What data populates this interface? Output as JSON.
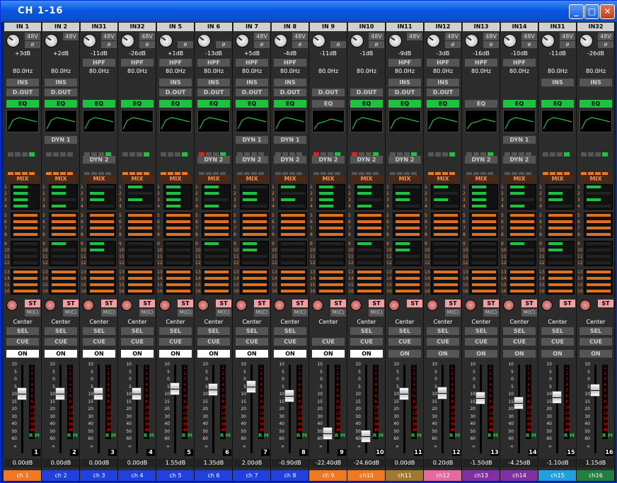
{
  "window": {
    "title": "CH 1-16",
    "min_label": "_",
    "max_label": "□",
    "close_label": "✕"
  },
  "labels": {
    "mix": "MIX",
    "st": "ST",
    "mc": "M(C)",
    "sel": "SEL",
    "cue": "CUE",
    "on": "ON",
    "ins": "INS",
    "dout": "D.OUT",
    "eq": "EQ",
    "dyn1": "DYN 1",
    "dyn2": "DYN 2",
    "hpf": "HPF",
    "rm": "R M",
    "b48": "48V",
    "phase": "ø"
  },
  "fader_scale": [
    "10",
    "5",
    "0",
    "5",
    "10",
    "15",
    "20",
    "30",
    "40",
    "50",
    "60",
    "∞"
  ],
  "meter_scale": [
    "1",
    "2",
    "3",
    "4",
    "5",
    "6",
    "8",
    "10",
    "12",
    "20",
    "30",
    "40"
  ],
  "mix_numbers": {
    "g1": [
      "1",
      "2",
      "3",
      "4"
    ],
    "g2": [
      "5",
      "6",
      "7",
      "8"
    ],
    "g3": [
      "9",
      "10",
      "11",
      "12"
    ],
    "g4": [
      "13",
      "14",
      "15",
      "16"
    ]
  },
  "channels": [
    {
      "input": "IN 1",
      "gain": "+3dB",
      "hpf_freq": "80.0Hz",
      "b48": false,
      "phase": false,
      "hpf": true,
      "ins": false,
      "dout": false,
      "eq": true,
      "dyn1": true,
      "dyn2": true,
      "pan": "Center",
      "mc": false,
      "sel": false,
      "on": true,
      "level": "0.00dB",
      "number": "1",
      "name": "ch 1",
      "color": "#f07820",
      "fader": 0.66
    },
    {
      "input": "IN 2",
      "gain": "+2dB",
      "hpf_freq": "80.0Hz",
      "b48": false,
      "phase": true,
      "hpf": true,
      "ins": false,
      "dout": false,
      "eq": true,
      "dyn1": false,
      "dyn2": true,
      "pan": "Center",
      "mc": false,
      "sel": false,
      "on": true,
      "level": "0.00dB",
      "number": "2",
      "name": "ch 2",
      "color": "#2040e0",
      "fader": 0.66
    },
    {
      "input": "IN31",
      "gain": "-11dB",
      "hpf_freq": "80.0Hz",
      "b48": false,
      "phase": false,
      "hpf": false,
      "ins": true,
      "dout": true,
      "eq": true,
      "dyn1": true,
      "dyn2": false,
      "pan": "Center",
      "mc": false,
      "sel": false,
      "on": true,
      "level": "0.00dB",
      "number": "3",
      "name": "ch 3",
      "color": "#2040e0",
      "fader": 0.66
    },
    {
      "input": "IN32",
      "gain": "-26dB",
      "hpf_freq": "80.0Hz",
      "b48": false,
      "phase": false,
      "hpf": false,
      "ins": true,
      "dout": true,
      "eq": true,
      "dyn1": true,
      "dyn2": true,
      "pan": "Center",
      "mc": false,
      "sel": false,
      "on": true,
      "level": "0.00dB",
      "number": "4",
      "name": "ch 4",
      "color": "#2040e0",
      "fader": 0.66
    },
    {
      "input": "IN 5",
      "gain": "+1dB",
      "hpf_freq": "80.0Hz",
      "b48": true,
      "phase": false,
      "hpf": false,
      "ins": false,
      "dout": false,
      "eq": true,
      "dyn1": true,
      "dyn2": true,
      "pan": "Center",
      "mc": false,
      "sel": false,
      "on": true,
      "level": "1.55dB",
      "number": "5",
      "name": "ch 5",
      "color": "#2040e0",
      "fader": 0.72
    },
    {
      "input": "IN 6",
      "gain": "-13dB",
      "hpf_freq": "80.0Hz",
      "b48": true,
      "phase": false,
      "hpf": false,
      "ins": false,
      "dout": false,
      "eq": true,
      "dyn1": true,
      "dyn2": false,
      "pan": "Center",
      "mc": false,
      "sel": false,
      "on": true,
      "level": "1.35dB",
      "number": "6",
      "name": "ch 6",
      "color": "#2040e0",
      "fader": 0.71
    },
    {
      "input": "IN 7",
      "gain": "+5dB",
      "hpf_freq": "80.0Hz",
      "b48": false,
      "phase": false,
      "hpf": false,
      "ins": false,
      "dout": false,
      "eq": true,
      "dyn1": false,
      "dyn2": false,
      "pan": "Center",
      "mc": false,
      "sel": false,
      "on": true,
      "level": "2.00dB",
      "number": "7",
      "name": "ch 7",
      "color": "#2040e0",
      "fader": 0.74
    },
    {
      "input": "IN 8",
      "gain": "-4dB",
      "hpf_freq": "80.0Hz",
      "b48": false,
      "phase": false,
      "hpf": false,
      "ins": false,
      "dout": false,
      "eq": true,
      "dyn1": false,
      "dyn2": false,
      "pan": "Center",
      "mc": false,
      "sel": false,
      "on": true,
      "level": "-0.90dB",
      "number": "8",
      "name": "ch 8",
      "color": "#2040e0",
      "fader": 0.63
    },
    {
      "input": "IN 9",
      "gain": "-11dB",
      "hpf_freq": "80.0Hz",
      "b48": true,
      "phase": false,
      "hpf": true,
      "ins": true,
      "dout": false,
      "eq": false,
      "dyn1": true,
      "dyn2": false,
      "pan": "Center",
      "mc": false,
      "sel": true,
      "on": true,
      "level": "-22.40dB",
      "number": "9",
      "name": "ch 9",
      "color": "#f07820",
      "fader": 0.19
    },
    {
      "input": "IN10",
      "gain": "-1dB",
      "hpf_freq": "80.0Hz",
      "b48": false,
      "phase": false,
      "hpf": true,
      "ins": true,
      "dout": false,
      "eq": true,
      "dyn1": true,
      "dyn2": false,
      "pan": "Center",
      "mc": false,
      "sel": false,
      "on": true,
      "level": "-24.60dB",
      "number": "10",
      "name": "ch10",
      "color": "#f07820",
      "fader": 0.16
    },
    {
      "input": "IN11",
      "gain": "-9dB",
      "hpf_freq": "80.0Hz",
      "b48": false,
      "phase": true,
      "hpf": false,
      "ins": false,
      "dout": false,
      "eq": true,
      "dyn1": true,
      "dyn2": false,
      "pan": "Center",
      "mc": true,
      "sel": false,
      "on": false,
      "level": "0.00dB",
      "number": "11",
      "name": "ch11",
      "color": "#a07830",
      "fader": 0.66
    },
    {
      "input": "IN12",
      "gain": "-3dB",
      "hpf_freq": "80.0Hz",
      "b48": false,
      "phase": false,
      "hpf": false,
      "ins": false,
      "dout": false,
      "eq": true,
      "dyn1": true,
      "dyn2": true,
      "pan": "Center",
      "mc": false,
      "sel": false,
      "on": false,
      "level": "0.20dB",
      "number": "12",
      "name": "ch12",
      "color": "#e868a0",
      "fader": 0.67
    },
    {
      "input": "IN13",
      "gain": "-16dB",
      "hpf_freq": "80.0Hz",
      "b48": false,
      "phase": false,
      "hpf": false,
      "ins": true,
      "dout": true,
      "eq": false,
      "dyn1": true,
      "dyn2": false,
      "pan": "Center",
      "mc": false,
      "sel": false,
      "on": false,
      "level": "-1.50dB",
      "number": "13",
      "name": "ch13",
      "color": "#8030a0",
      "fader": 0.61
    },
    {
      "input": "IN14",
      "gain": "-10dB",
      "hpf_freq": "80.0Hz",
      "b48": false,
      "phase": false,
      "hpf": false,
      "ins": true,
      "dout": true,
      "eq": true,
      "dyn1": false,
      "dyn2": false,
      "pan": "Center",
      "mc": false,
      "sel": false,
      "on": false,
      "level": "-4.25dB",
      "number": "14",
      "name": "ch14",
      "color": "#8030a0",
      "fader": 0.55
    },
    {
      "input": "IN31",
      "gain": "-11dB",
      "hpf_freq": "80.0Hz",
      "b48": false,
      "phase": false,
      "hpf": true,
      "ins": false,
      "dout": true,
      "eq": true,
      "dyn1": true,
      "dyn2": true,
      "pan": "Center",
      "mc": true,
      "sel": false,
      "on": false,
      "level": "-1.10dB",
      "number": "15",
      "name": "ch15",
      "color": "#20a0e0",
      "fader": 0.62
    },
    {
      "input": "IN32",
      "gain": "-26dB",
      "hpf_freq": "80.0Hz",
      "b48": false,
      "phase": false,
      "hpf": true,
      "ins": false,
      "dout": true,
      "eq": true,
      "dyn1": true,
      "dyn2": true,
      "pan": "Center",
      "mc": true,
      "sel": false,
      "on": false,
      "level": "1.15dB",
      "number": "16",
      "name": "ch16",
      "color": "#208040",
      "fader": 0.7
    }
  ]
}
